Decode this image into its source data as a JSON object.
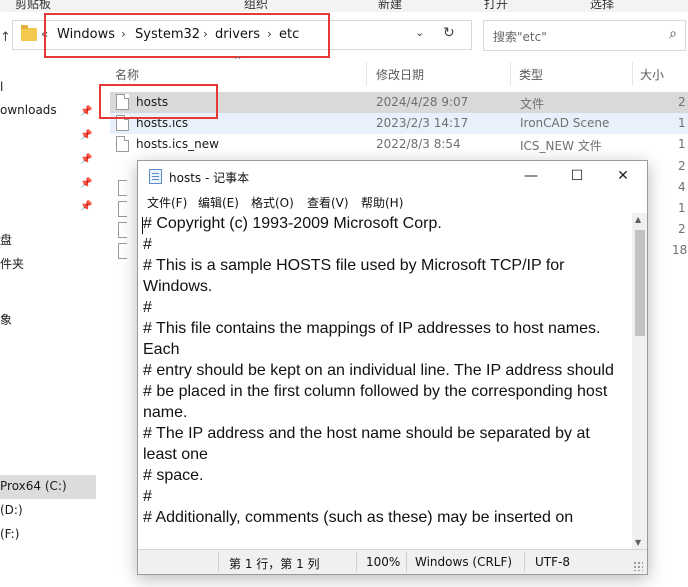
{
  "ribbon": {
    "labels": [
      "剪贴板",
      "组织",
      "新建",
      "打开",
      "选择"
    ]
  },
  "address": {
    "crumbs": [
      "Windows",
      "System32",
      "drivers",
      "etc"
    ],
    "overflow": "«",
    "up": "↑",
    "dropdown": "⌄",
    "refresh": "↻"
  },
  "search": {
    "placeholder": "搜索\"etc\"",
    "icon": "search-icon"
  },
  "nav": {
    "items": [
      "l",
      "ownloads",
      "",
      "",
      "",
      "",
      "盘",
      "件夹",
      "象",
      "Prox64 (C:)",
      "(D:)",
      "(F:)"
    ],
    "selected": "Prox64 (C:)"
  },
  "columns": {
    "name": "名称",
    "modified": "修改日期",
    "type": "类型",
    "size": "大小",
    "sort": "^"
  },
  "files": [
    {
      "name": "hosts",
      "date": "2024/4/28 9:07",
      "type": "文件",
      "size": "2",
      "state": "selected"
    },
    {
      "name": "hosts.ics",
      "date": "2023/2/3 14:17",
      "type": "IronCAD Scene",
      "size": "1",
      "state": "hover"
    },
    {
      "name": "hosts.ics_new",
      "date": "2022/8/3 8:54",
      "type": "ICS_NEW 文件",
      "size": "1",
      "state": ""
    }
  ],
  "hidden_sizes": [
    "2",
    "4",
    "1",
    "2",
    "18"
  ],
  "notepad": {
    "title": "hosts - 记事本",
    "controls": {
      "minimize": "—",
      "maximize": "☐",
      "close": "✕"
    },
    "menu": [
      "文件(F)",
      "编辑(E)",
      "格式(O)",
      "查看(V)",
      "帮助(H)"
    ],
    "content": "# Copyright (c) 1993-2009 Microsoft Corp.\n#\n# This is a sample HOSTS file used by Microsoft TCP/IP for Windows.\n#\n# This file contains the mappings of IP addresses to host names. Each\n# entry should be kept on an individual line. The IP address should\n# be placed in the first column followed by the corresponding host name.\n# The IP address and the host name should be separated by at least one\n# space.\n#\n# Additionally, comments (such as these) may be inserted on",
    "status": {
      "position": "第 1 行，第 1 列",
      "zoom": "100%",
      "eol": "Windows (CRLF)",
      "encoding": "UTF-8"
    }
  },
  "accent_colors": {
    "highlight_box": "#e53935",
    "selection": "#d9d9d9",
    "hover": "#e8f1fb"
  }
}
